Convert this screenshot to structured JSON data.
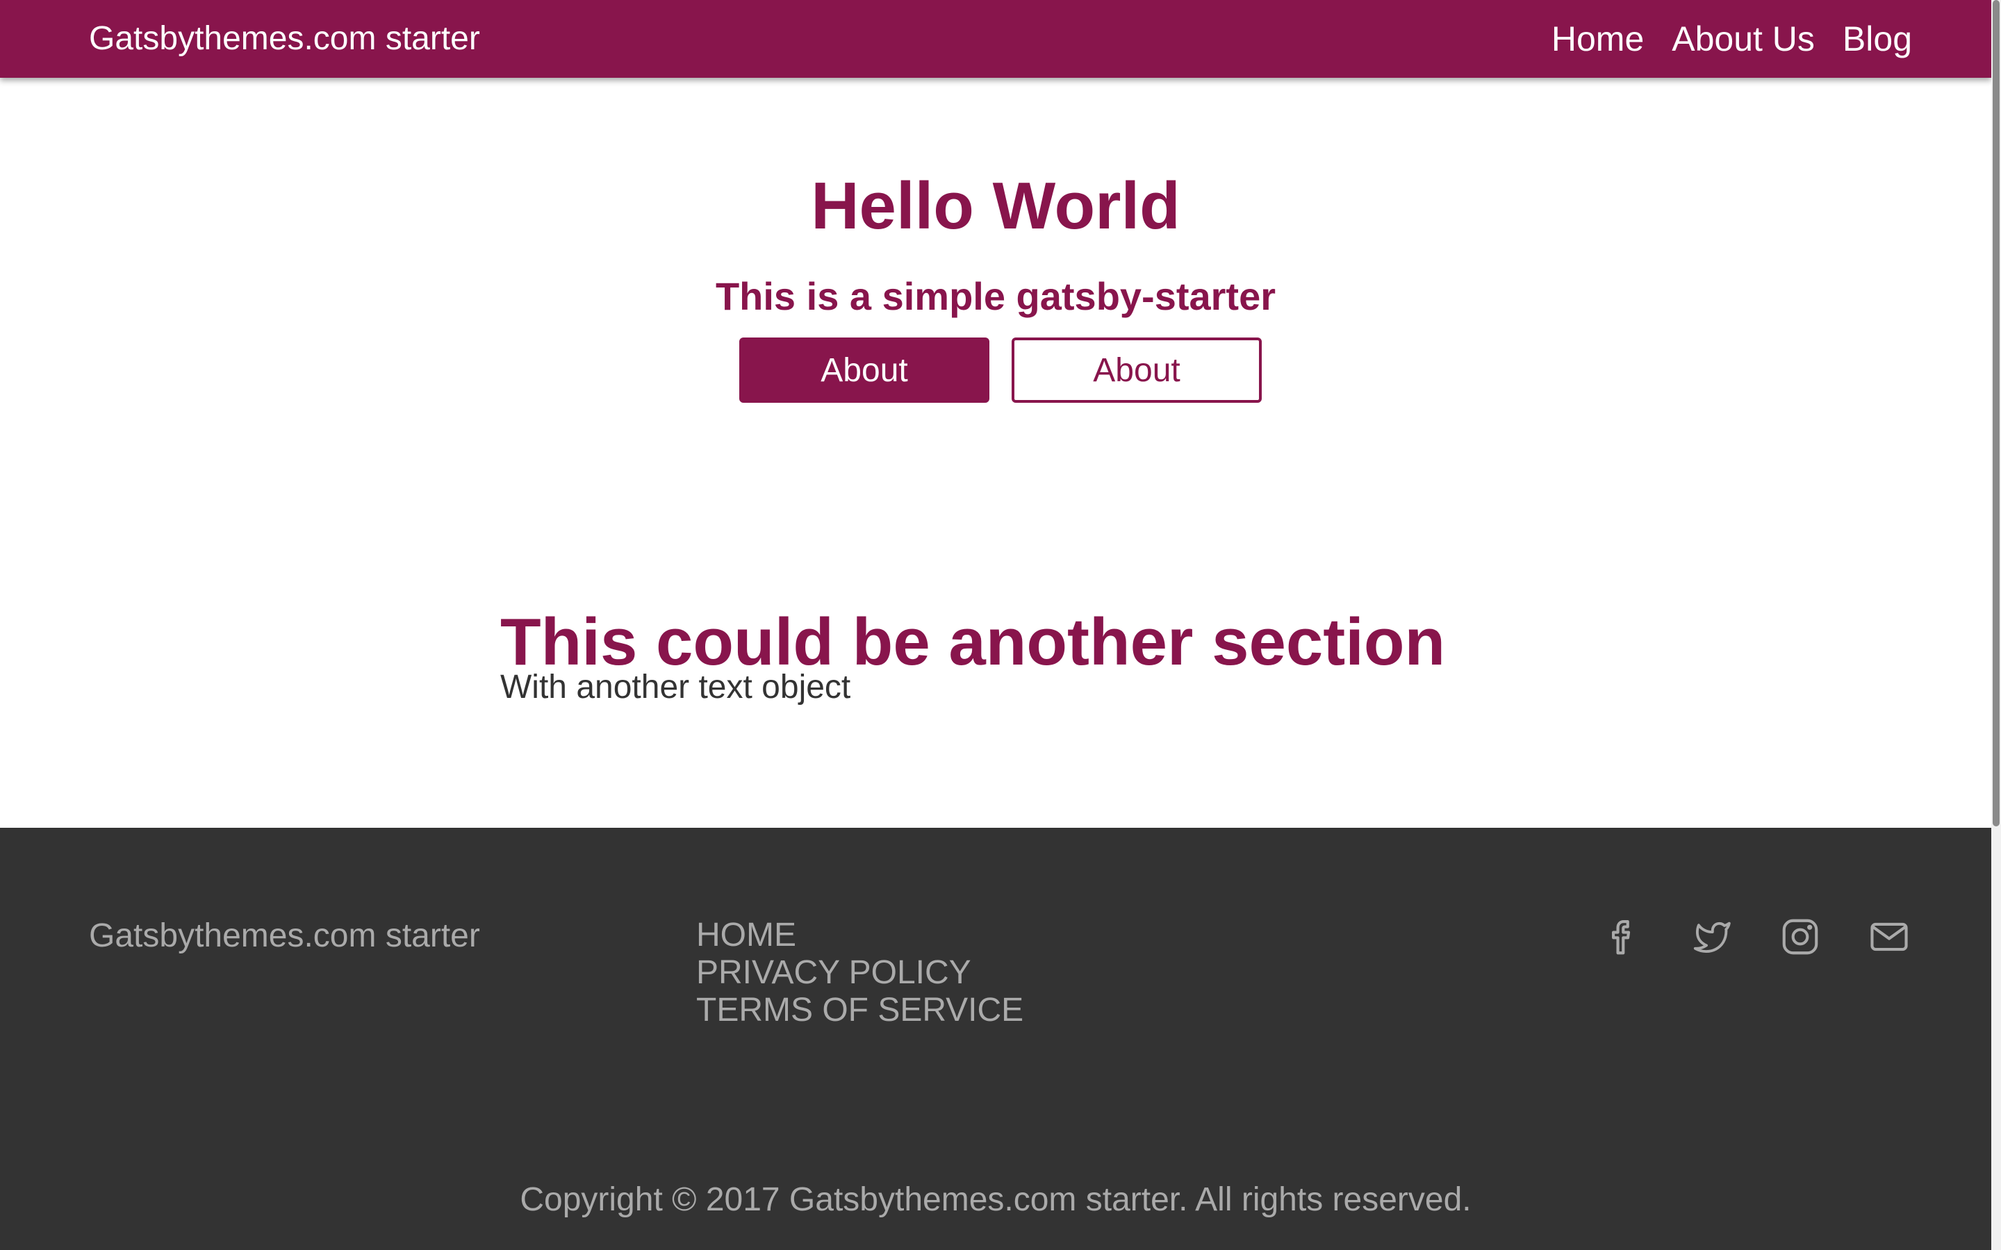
{
  "header": {
    "brand": "Gatsbythemes.com starter",
    "nav": [
      {
        "label": "Home"
      },
      {
        "label": "About Us"
      },
      {
        "label": "Blog"
      }
    ]
  },
  "hero": {
    "title": "Hello World",
    "subtitle": "This is a simple gatsby-starter",
    "primary_button": "About",
    "secondary_button": "About"
  },
  "section": {
    "title": "This could be another section",
    "text": "With another text object"
  },
  "footer": {
    "brand": "Gatsbythemes.com starter",
    "links": [
      {
        "label": "HOME"
      },
      {
        "label": "PRIVACY POLICY"
      },
      {
        "label": "TERMS OF SERVICE"
      }
    ],
    "social_icons": [
      "facebook-icon",
      "twitter-icon",
      "instagram-icon",
      "mail-icon"
    ],
    "copyright": "Copyright © 2017 Gatsbythemes.com starter. All rights reserved."
  },
  "colors": {
    "brand": "#88154c",
    "footer_bg": "#333333",
    "footer_text": "#aaaaaa",
    "body_text": "#333333"
  }
}
